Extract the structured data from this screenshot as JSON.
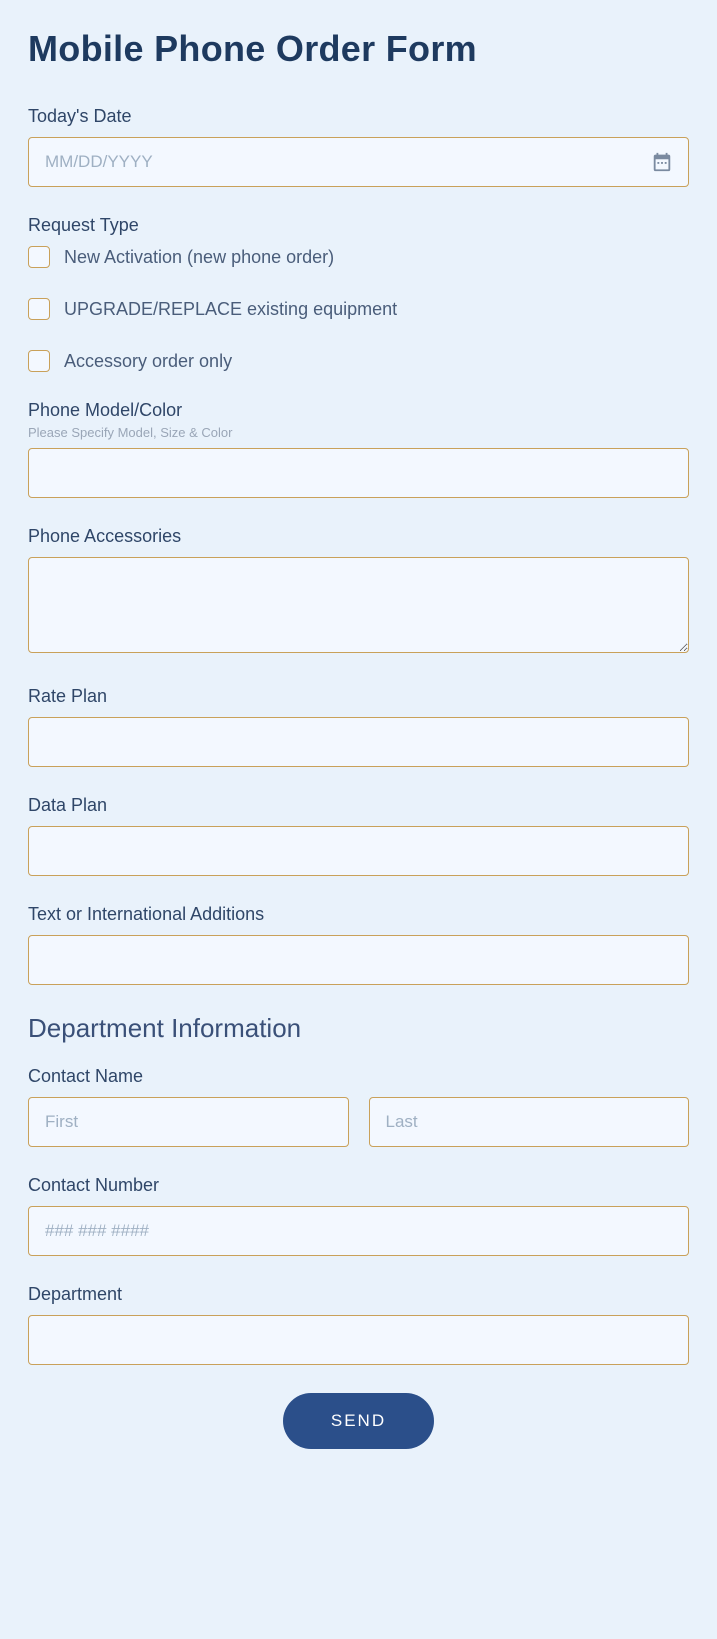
{
  "title": "Mobile Phone Order Form",
  "date": {
    "label": "Today's Date",
    "placeholder": "MM/DD/YYYY"
  },
  "request_type": {
    "label": "Request Type",
    "options": [
      "New Activation (new phone order)",
      "UPGRADE/REPLACE existing equipment",
      "Accessory order only"
    ]
  },
  "phone_model": {
    "label": "Phone Model/Color",
    "sub": "Please Specify Model, Size & Color"
  },
  "accessories": {
    "label": "Phone Accessories"
  },
  "rate_plan": {
    "label": "Rate Plan"
  },
  "data_plan": {
    "label": "Data Plan"
  },
  "intl": {
    "label": "Text or International Additions"
  },
  "dept_section": "Department Information",
  "contact_name": {
    "label": "Contact Name",
    "first_placeholder": "First",
    "last_placeholder": "Last"
  },
  "contact_number": {
    "label": "Contact Number",
    "placeholder": "### ### ####"
  },
  "department": {
    "label": "Department"
  },
  "submit": "SEND"
}
